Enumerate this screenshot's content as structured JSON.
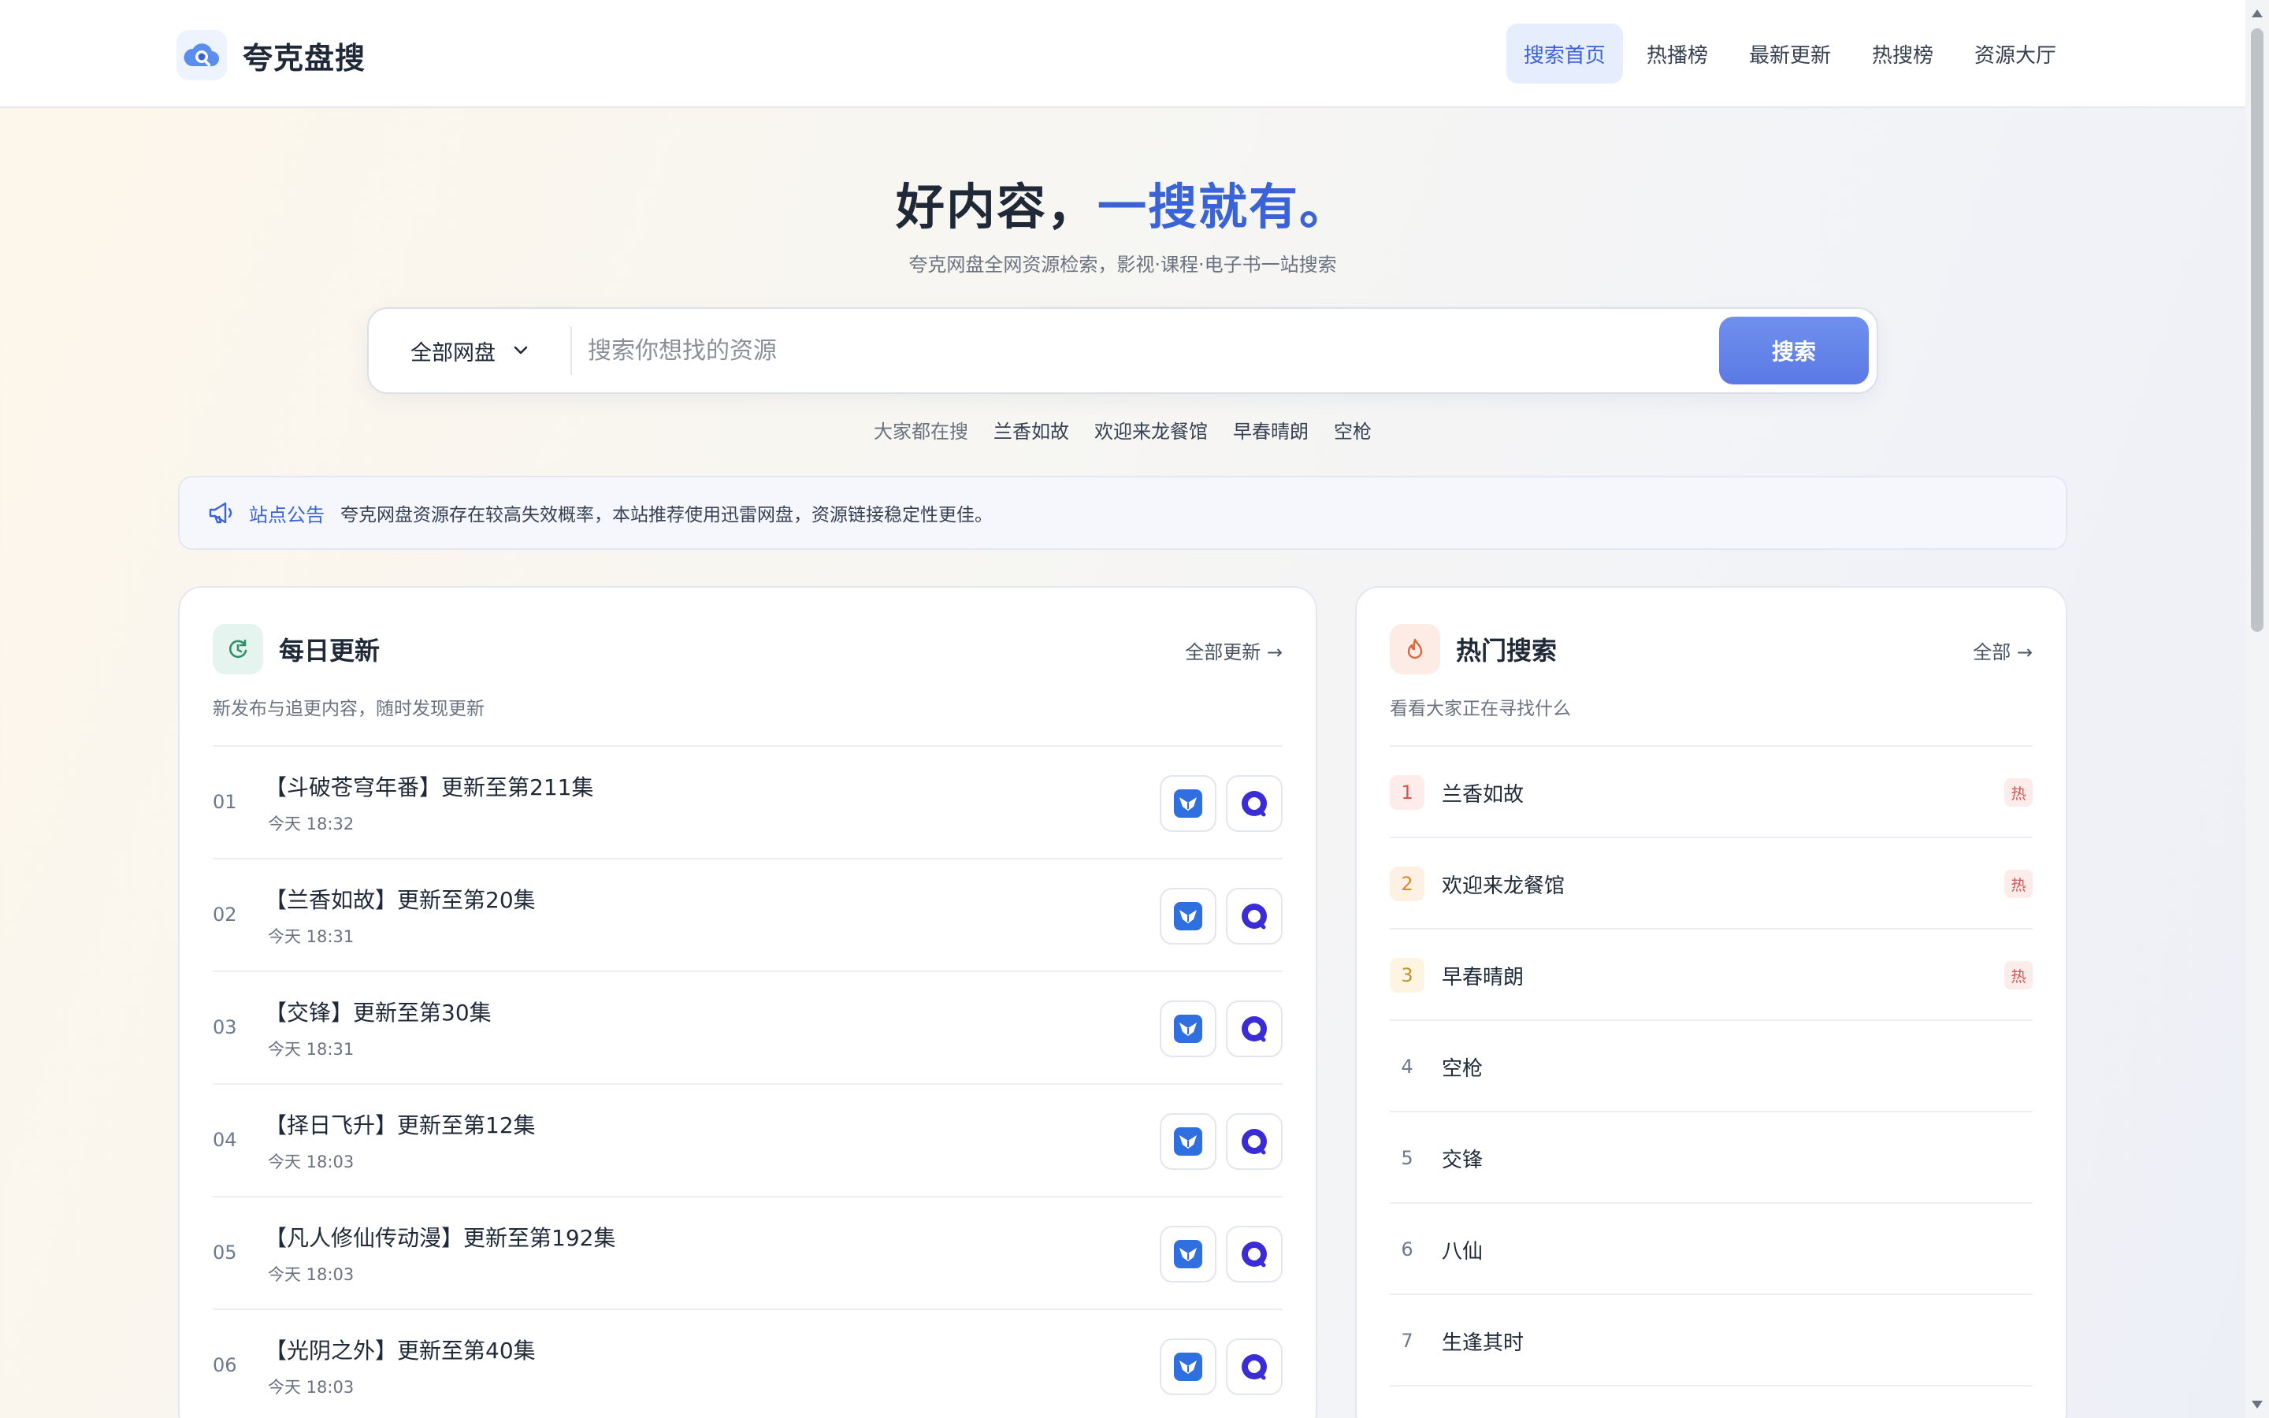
{
  "header": {
    "logo_text": "夸克盘搜",
    "nav": [
      {
        "label": "搜索首页",
        "active": true
      },
      {
        "label": "热播榜",
        "active": false
      },
      {
        "label": "最新更新",
        "active": false
      },
      {
        "label": "热搜榜",
        "active": false
      },
      {
        "label": "资源大厅",
        "active": false
      }
    ]
  },
  "hero": {
    "title_main": "好内容，",
    "title_accent": "一搜就有。",
    "subtitle": "夸克网盘全网资源检索，影视·课程·电子书一站搜索"
  },
  "search": {
    "select_value": "全部网盘",
    "placeholder": "搜索你想找的资源",
    "value": "",
    "button_label": "搜索",
    "hot_label": "大家都在搜",
    "hot_tags": [
      "兰香如故",
      "欢迎来龙餐馆",
      "早春晴朗",
      "空枪"
    ]
  },
  "notice": {
    "title": "站点公告",
    "text": "夸克网盘资源存在较高失效概率，本站推荐使用迅雷网盘，资源链接稳定性更佳。"
  },
  "daily": {
    "title": "每日更新",
    "more": "全部更新 →",
    "subtitle": "新发布与追更内容，随时发现更新",
    "items": [
      {
        "num": "01",
        "title": "【斗破苍穹年番】更新至第211集",
        "time": "今天 18:32"
      },
      {
        "num": "02",
        "title": "【兰香如故】更新至第20集",
        "time": "今天 18:31"
      },
      {
        "num": "03",
        "title": "【交锋】更新至第30集",
        "time": "今天 18:31"
      },
      {
        "num": "04",
        "title": "【择日飞升】更新至第12集",
        "time": "今天 18:03"
      },
      {
        "num": "05",
        "title": "【凡人修仙传动漫】更新至第192集",
        "time": "今天 18:03"
      },
      {
        "num": "06",
        "title": "【光阴之外】更新至第40集",
        "time": "今天 18:03"
      }
    ]
  },
  "hot": {
    "title": "热门搜索",
    "more": "全部 →",
    "subtitle": "看看大家正在寻找什么",
    "badge": "热",
    "items": [
      {
        "rank": "1",
        "name": "兰香如故",
        "hot": true
      },
      {
        "rank": "2",
        "name": "欢迎来龙餐馆",
        "hot": true
      },
      {
        "rank": "3",
        "name": "早春晴朗",
        "hot": true
      },
      {
        "rank": "4",
        "name": "空枪",
        "hot": false
      },
      {
        "rank": "5",
        "name": "交锋",
        "hot": false
      },
      {
        "rank": "6",
        "name": "八仙",
        "hot": false
      },
      {
        "rank": "7",
        "name": "生逢其时",
        "hot": false
      }
    ]
  },
  "icons": {
    "logo": "cloud-search-icon",
    "dropdown": "chevron-down-icon",
    "notice": "megaphone-icon",
    "daily": "refresh-clock-icon",
    "hot": "flame-icon",
    "pan_a": "bird-icon",
    "pan_b": "ring-icon"
  },
  "colors": {
    "accent": "#3b63d8",
    "button": "#6582ea",
    "hot_red": "#d9534f"
  }
}
